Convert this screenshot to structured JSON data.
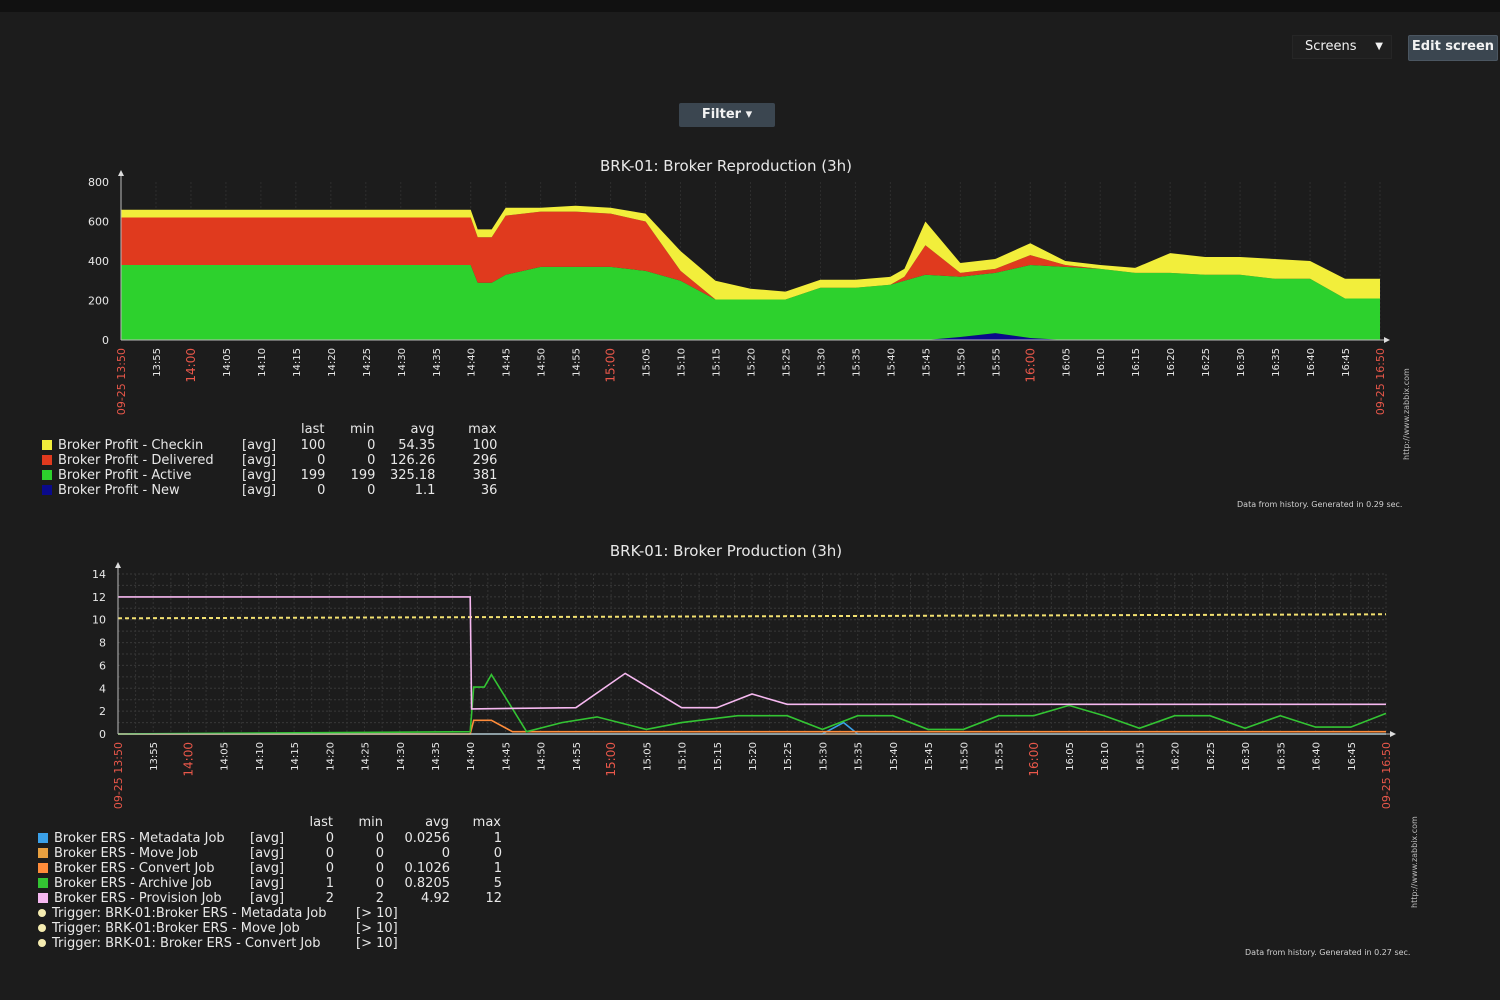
{
  "header": {
    "screens_label": "Screens",
    "edit_label": "Edit screen",
    "filter_label": "Filter ▾"
  },
  "chart_data": [
    {
      "type": "area",
      "title": "BRK-01: Broker Reproduction (3h)",
      "ylim": [
        0,
        800
      ],
      "y_ticks": [
        "0",
        "200",
        "400",
        "600",
        "800"
      ],
      "x_start_label": "09-25 13:50",
      "x_end_label": "09-25 16:50",
      "x_tick_labels": [
        "13:55",
        "14:00",
        "14:05",
        "14:10",
        "14:15",
        "14:20",
        "14:25",
        "14:30",
        "14:35",
        "14:40",
        "14:45",
        "14:50",
        "14:55",
        "15:00",
        "15:05",
        "15:10",
        "15:15",
        "15:20",
        "15:25",
        "15:30",
        "15:35",
        "15:40",
        "15:45",
        "15:50",
        "15:55",
        "16:00",
        "16:05",
        "16:10",
        "16:15",
        "16:20",
        "16:25",
        "16:30",
        "16:35",
        "16:40",
        "16:45"
      ],
      "red_tick_labels": [
        "14:00",
        "15:00",
        "16:00"
      ],
      "x_minutes": [
        0,
        5,
        10,
        15,
        20,
        25,
        30,
        35,
        40,
        45,
        50,
        51,
        53,
        55,
        60,
        65,
        70,
        75,
        80,
        85,
        90,
        95,
        100,
        105,
        110,
        112,
        115,
        120,
        125,
        130,
        135,
        140,
        145,
        150,
        155,
        160,
        165,
        170,
        175,
        180
      ],
      "series": [
        {
          "name": "Broker Profit - New",
          "color": "#0a0a8c",
          "values": [
            0,
            0,
            0,
            0,
            0,
            0,
            0,
            0,
            0,
            0,
            0,
            0,
            0,
            0,
            0,
            0,
            0,
            0,
            0,
            0,
            0,
            0,
            0,
            0,
            0,
            0,
            0,
            15,
            35,
            10,
            0,
            0,
            0,
            0,
            0,
            0,
            0,
            0,
            0,
            0
          ]
        },
        {
          "name": "Broker Profit - Active",
          "color": "#2dd12d",
          "values": [
            380,
            380,
            380,
            380,
            380,
            380,
            380,
            380,
            380,
            380,
            380,
            290,
            290,
            330,
            370,
            370,
            370,
            350,
            300,
            205,
            205,
            205,
            265,
            265,
            280,
            300,
            330,
            305,
            305,
            370,
            370,
            360,
            340,
            340,
            330,
            330,
            310,
            310,
            210,
            210
          ]
        },
        {
          "name": "Broker Profit - Delivered",
          "color": "#e03a1e",
          "values": [
            240,
            240,
            240,
            240,
            240,
            240,
            240,
            240,
            240,
            240,
            240,
            230,
            230,
            300,
            280,
            280,
            270,
            250,
            50,
            0,
            0,
            0,
            0,
            0,
            0,
            20,
            150,
            20,
            20,
            50,
            10,
            0,
            0,
            0,
            0,
            0,
            0,
            0,
            0,
            0
          ]
        },
        {
          "name": "Broker Profit - Checkin",
          "color": "#f2ee3b",
          "values": [
            40,
            40,
            40,
            40,
            40,
            40,
            40,
            40,
            40,
            40,
            40,
            40,
            40,
            40,
            20,
            30,
            30,
            40,
            100,
            95,
            55,
            40,
            40,
            40,
            40,
            40,
            120,
            50,
            50,
            60,
            20,
            20,
            25,
            100,
            90,
            90,
            100,
            90,
            100,
            100
          ]
        }
      ],
      "legend": {
        "headers": [
          "last",
          "min",
          "avg",
          "max"
        ],
        "rows": [
          {
            "name": "Broker Profit - Checkin",
            "color": "#f2ee3b",
            "fn": "[avg]",
            "last": "100",
            "min": "0",
            "avg": "54.35",
            "max": "100"
          },
          {
            "name": "Broker Profit - Delivered",
            "color": "#e03a1e",
            "fn": "[avg]",
            "last": "0",
            "min": "0",
            "avg": "126.26",
            "max": "296"
          },
          {
            "name": "Broker Profit - Active",
            "color": "#2dd12d",
            "fn": "[avg]",
            "last": "199",
            "min": "199",
            "avg": "325.18",
            "max": "381"
          },
          {
            "name": "Broker Profit - New",
            "color": "#0a0a8c",
            "fn": "[avg]",
            "last": "0",
            "min": "0",
            "avg": "1.1",
            "max": "36"
          }
        ]
      },
      "footer": "Data from history. Generated in 0.29 sec.",
      "url": "http://www.zabbix.com"
    },
    {
      "type": "line",
      "title": "BRK-01: Broker Production (3h)",
      "ylim": [
        0,
        14
      ],
      "y_ticks": [
        "0",
        "2",
        "4",
        "6",
        "8",
        "10",
        "12",
        "14"
      ],
      "x_start_label": "09-25 13:50",
      "x_end_label": "09-25 16:50",
      "x_tick_labels": [
        "13:55",
        "14:00",
        "14:05",
        "14:10",
        "14:15",
        "14:20",
        "14:25",
        "14:30",
        "14:35",
        "14:40",
        "14:45",
        "14:50",
        "14:55",
        "15:00",
        "15:05",
        "15:10",
        "15:15",
        "15:20",
        "15:25",
        "15:30",
        "15:35",
        "15:40",
        "15:45",
        "15:50",
        "15:55",
        "16:00",
        "16:05",
        "16:10",
        "16:15",
        "16:20",
        "16:25",
        "16:30",
        "16:35",
        "16:40",
        "16:45"
      ],
      "red_tick_labels": [
        "14:00",
        "15:00",
        "16:00"
      ],
      "trigger_level": 10.3,
      "series": [
        {
          "name": "Broker ERS - Provision Job",
          "color": "#f6b8f0",
          "x": [
            0,
            50,
            50.2,
            65,
            72,
            80,
            85,
            90,
            95,
            180
          ],
          "y": [
            12,
            12,
            2.2,
            2.3,
            5.3,
            2.3,
            2.3,
            3.5,
            2.6,
            2.6
          ]
        },
        {
          "name": "Broker ERS - Archive Job",
          "color": "#33c433",
          "x": [
            0,
            50,
            50.5,
            52,
            53,
            58,
            63,
            68,
            75,
            80,
            88,
            95,
            100,
            105,
            110,
            115,
            120,
            125,
            130,
            135,
            140,
            145,
            150,
            155,
            160,
            165,
            170,
            175,
            180
          ],
          "y": [
            0,
            0.2,
            4.1,
            4.1,
            5.2,
            0.2,
            1.0,
            1.5,
            0.4,
            1.0,
            1.6,
            1.6,
            0.4,
            1.6,
            1.6,
            0.4,
            0.4,
            1.6,
            1.6,
            2.5,
            1.6,
            0.5,
            1.6,
            1.6,
            0.5,
            1.6,
            0.6,
            0.6,
            1.8
          ]
        },
        {
          "name": "Broker ERS - Convert Job",
          "color": "#ff8c3a",
          "x": [
            0,
            50,
            50.5,
            53,
            56,
            180
          ],
          "y": [
            0,
            0,
            1.2,
            1.2,
            0.2,
            0.2
          ]
        },
        {
          "name": "Broker ERS - Metadata Job",
          "color": "#3aa0e8",
          "x": [
            0,
            100,
            103,
            105,
            180
          ],
          "y": [
            0,
            0,
            1.0,
            0,
            0
          ]
        },
        {
          "name": "Broker ERS - Move Job",
          "color": "#e8a040",
          "x": [
            0,
            180
          ],
          "y": [
            0,
            0
          ]
        }
      ],
      "legend": {
        "headers": [
          "last",
          "min",
          "avg",
          "max"
        ],
        "rows": [
          {
            "name": "Broker ERS - Metadata Job",
            "color": "#3aa0e8",
            "fn": "[avg]",
            "last": "0",
            "min": "0",
            "avg": "0.0256",
            "max": "1"
          },
          {
            "name": "Broker ERS - Move Job",
            "color": "#e8a040",
            "fn": "[avg]",
            "last": "0",
            "min": "0",
            "avg": "0",
            "max": "0"
          },
          {
            "name": "Broker ERS - Convert Job",
            "color": "#ff8c3a",
            "fn": "[avg]",
            "last": "0",
            "min": "0",
            "avg": "0.1026",
            "max": "1"
          },
          {
            "name": "Broker ERS - Archive Job",
            "color": "#33c433",
            "fn": "[avg]",
            "last": "1",
            "min": "0",
            "avg": "0.8205",
            "max": "5"
          },
          {
            "name": "Broker ERS - Provision Job",
            "color": "#f6b8f0",
            "fn": "[avg]",
            "last": "2",
            "min": "2",
            "avg": "4.92",
            "max": "12"
          }
        ],
        "triggers": [
          {
            "name": "Trigger: BRK-01:Broker ERS - Metadata Job",
            "condition": "[> 10]"
          },
          {
            "name": "Trigger: BRK-01:Broker ERS - Move Job",
            "condition": "[> 10]"
          },
          {
            "name": "Trigger: BRK-01: Broker ERS - Convert Job",
            "condition": "[> 10]"
          }
        ]
      },
      "footer": "Data from history. Generated in 0.27 sec.",
      "url": "http://www.zabbix.com"
    }
  ]
}
